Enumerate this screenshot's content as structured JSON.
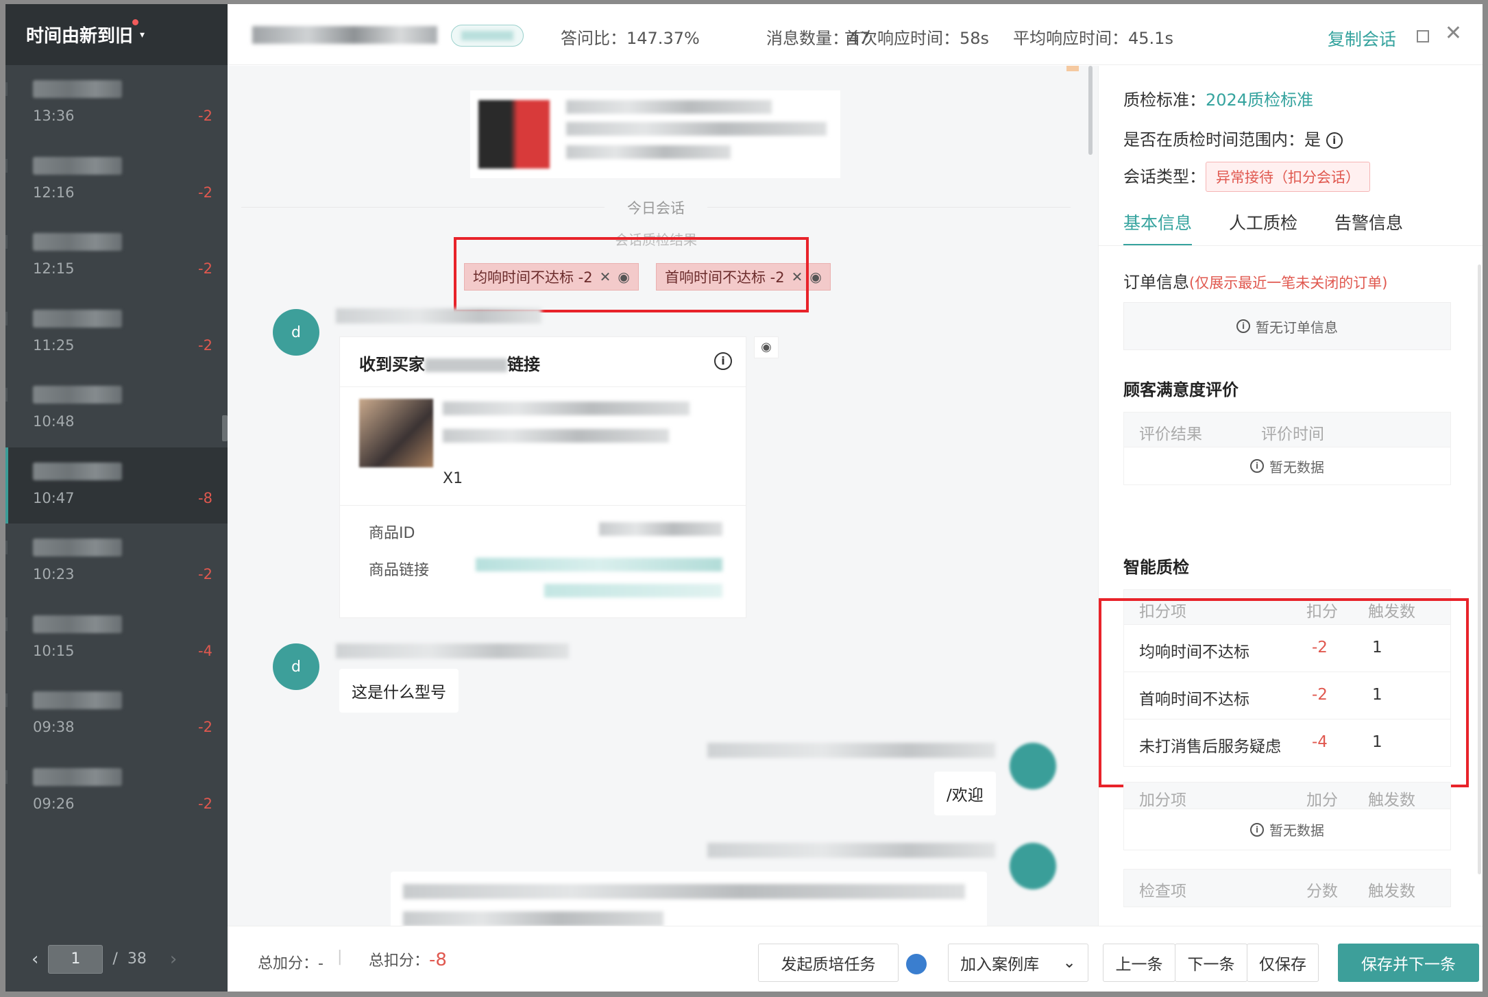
{
  "left": {
    "sort_label": "时间由新到旧",
    "conversations": [
      {
        "time": "13:36",
        "score": "-2"
      },
      {
        "time": "12:16",
        "score": "-2"
      },
      {
        "time": "12:15",
        "score": "-2"
      },
      {
        "time": "11:25",
        "score": "-2"
      },
      {
        "time": "10:48",
        "score": ""
      },
      {
        "time": "10:47",
        "score": "-8"
      },
      {
        "time": "10:23",
        "score": "-2"
      },
      {
        "time": "10:15",
        "score": "-4"
      },
      {
        "time": "09:38",
        "score": "-2"
      },
      {
        "time": "09:26",
        "score": "-2"
      }
    ],
    "pager": {
      "current": "1",
      "separator": "/",
      "total": "38"
    }
  },
  "topbar": {
    "metrics": [
      {
        "label": "答问比：",
        "value": "147.37%"
      },
      {
        "label": "消息数量：",
        "value": "47"
      },
      {
        "label": "首次响应时间：",
        "value": "58s"
      },
      {
        "label": "平均响应时间：",
        "value": "45.1s"
      }
    ],
    "copy_label": "复制会话"
  },
  "chat": {
    "divider": "今日会话",
    "qc_result_title": "会话质检结果",
    "qc_tags": [
      {
        "label": "均响时间不达标 -2"
      },
      {
        "label": "首响时间不达标 -2"
      }
    ],
    "customer_avatar_letter": "d",
    "goods_card": {
      "title": "收到买家",
      "title_tail": "链接",
      "qty": "X1",
      "id_label": "商品ID",
      "link_label": "商品链接"
    },
    "message_1": "这是什么型号",
    "agent_reply": "/欢迎"
  },
  "bottombar": {
    "total_add_label": "总加分：",
    "total_add_value": "-",
    "total_deduct_label": "总扣分：",
    "total_deduct_value": "-8",
    "train_button": "发起质培任务",
    "case_button": "加入案例库",
    "prev_button": "上一条",
    "next_button": "下一条",
    "save_only_button": "仅保存",
    "save_next_button": "保存并下一条"
  },
  "right": {
    "standard_label": "质检标准：",
    "standard_value": "2024质检标准",
    "in_range_label": "是否在质检时间范围内：",
    "in_range_value": "是",
    "type_label": "会话类型：",
    "type_value": "异常接待（扣分会话）",
    "tabs": [
      "基本信息",
      "人工质检",
      "告警信息"
    ],
    "order_title": "订单信息",
    "order_note": "(仅展示最近一笔未关闭的订单)",
    "order_empty": "暂无订单信息",
    "satisfaction_title": "顾客满意度评价",
    "satisfaction_cols": [
      "评价结果",
      "评价时间"
    ],
    "no_data": "暂无数据",
    "smart_title": "智能质检",
    "deduct_cols": [
      "扣分项",
      "扣分",
      "触发数"
    ],
    "deduct_rows": [
      {
        "item": "均响时间不达标",
        "score": "-2",
        "count": "1"
      },
      {
        "item": "首响时间不达标",
        "score": "-2",
        "count": "1"
      },
      {
        "item": "未打消售后服务疑虑",
        "score": "-4",
        "count": "1"
      }
    ],
    "add_cols": [
      "加分项",
      "加分",
      "触发数"
    ],
    "check_cols": [
      "检查项",
      "分数",
      "触发数"
    ]
  },
  "colors": {
    "accent": "#3d9f9a",
    "negative": "#e0584f",
    "highlight_frame": "#e8232a"
  }
}
